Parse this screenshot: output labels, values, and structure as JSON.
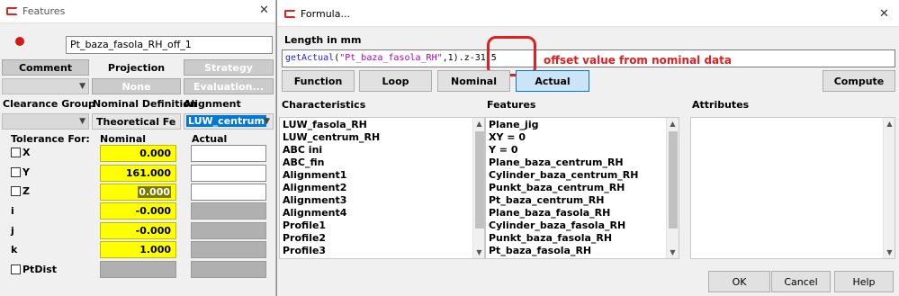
{
  "features_window": {
    "title": "Features",
    "feature_name": "Pt_baza_fasola_RH_off_1",
    "tabs": [
      "Comment",
      "Projection",
      "Strategy"
    ],
    "row2": {
      "none": "None",
      "evaluation": "Evaluation..."
    },
    "headers": {
      "clearance_group": "Clearance Group",
      "nominal_definition": "Nominal Definition",
      "alignment": "Alignment"
    },
    "nominal_definition_value": "Theoretical Fe",
    "alignment_value": "LUW_centrum",
    "table_headers": {
      "tolerance_for": "Tolerance For:",
      "nominal": "Nominal",
      "actual": "Actual"
    },
    "rows": [
      {
        "label": "X",
        "nominal": "0.000"
      },
      {
        "label": "Y",
        "nominal": "161.000"
      },
      {
        "label": "Z",
        "nominal": "0.000"
      },
      {
        "label": "i",
        "nominal": "-0.000"
      },
      {
        "label": "j",
        "nominal": "-0.000"
      },
      {
        "label": "k",
        "nominal": "1.000"
      },
      {
        "label": "PtDist",
        "nominal": ""
      }
    ]
  },
  "formula_window": {
    "title": "Formula...",
    "length_label": "Length in mm",
    "formula": {
      "func": "getActual",
      "open": "(",
      "arg": "\"Pt_baza_fasola_RH\"",
      "rest": ",1).z",
      "offset": "-31.5"
    },
    "annotation": "offset value from nominal data",
    "buttons": {
      "function": "Function",
      "loop": "Loop",
      "nominal": "Nominal",
      "actual": "Actual",
      "compute": "Compute"
    },
    "column_headers": {
      "characteristics": "Characteristics",
      "features": "Features",
      "attributes": "Attributes"
    },
    "characteristics": [
      "LUW_fasola_RH",
      "LUW_centrum_RH",
      "ABC ini",
      "ABC_fin",
      "Alignment1",
      "Alignment2",
      "Alignment3",
      "Alignment4",
      "Profile1",
      "Profile2",
      "Profile3"
    ],
    "features": [
      "Plane_jig",
      "XY = 0",
      "Y = 0",
      "Plane_baza_centrum_RH",
      "Cylinder_baza_centrum_RH",
      "Punkt_baza_centrum_RH",
      "Pt_baza_centrum_RH",
      "Plane_baza_fasola_RH",
      "Cylinder_baza_fasola_RH",
      "Punkt_baza_fasola_RH",
      "Pt_baza_fasola_RH"
    ],
    "footer_buttons": {
      "ok": "OK",
      "cancel": "Cancel",
      "help": "Help"
    }
  },
  "colors": {
    "yellow_field": "#ffff00",
    "annotation_red": "#e02020",
    "formula_func": "#1a1aff",
    "formula_string": "#b000b0",
    "actual_button": "#cce4f7"
  },
  "icons": {
    "record": "red-dot-icon",
    "app": "app-icon",
    "close": "close-icon"
  }
}
